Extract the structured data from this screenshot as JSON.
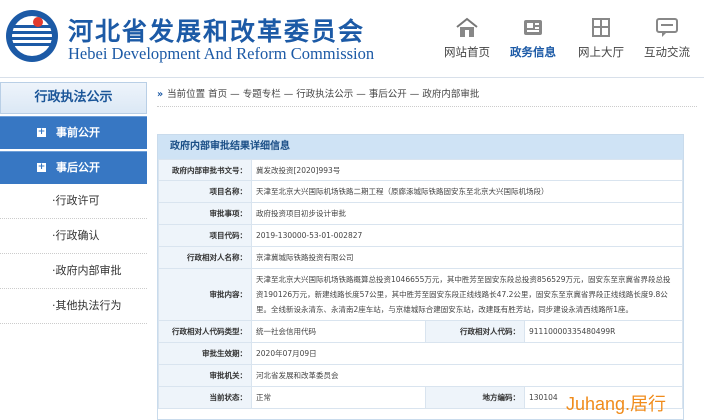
{
  "site": {
    "name_cn": "河北省发展和改革委员会",
    "name_en": "Hebei Development And Reform Commission",
    "brand_color": "#1c5aa6"
  },
  "nav": [
    {
      "label": "网站首页",
      "icon": "home-icon",
      "active": false
    },
    {
      "label": "政务信息",
      "icon": "news-icon",
      "active": true
    },
    {
      "label": "网上大厅",
      "icon": "hall-icon",
      "active": false
    },
    {
      "label": "互动交流",
      "icon": "chat-icon",
      "active": false
    }
  ],
  "sidebar": {
    "title": "行政执法公示",
    "cat1": "事前公开",
    "cat2": "事后公开",
    "items": [
      "·行政许可",
      "·行政确认",
      "·政府内部审批",
      "·其他执法行为"
    ]
  },
  "breadcrumb": "当前位置 首页 — 专题专栏 — 行政执法公示 — 事后公开 — 政府内部审批",
  "detail": {
    "title": "政府内部审批结果详细信息",
    "doc_no_label": "政府内部审批书文号：",
    "doc_no": "冀发改投资[2020]993号",
    "project_label": "项目名称：",
    "project": "天津至北京大兴国际机场铁路二期工程（原廊涿城际铁路固安东至北京大兴国际机场段）",
    "matter_label": "审批事项：",
    "matter": "政府投资项目初步设计审批",
    "code_label": "项目代码：",
    "code": "2019-130000-53-01-002827",
    "party_label": "行政相对人名称：",
    "party": "京津冀城际铁路投资有限公司",
    "content_label": "审批内容：",
    "content": "天津至北京大兴国际机场铁路概算总投资1046655万元，其中胜芳至固安东段总投资856529万元，固安东至京冀省界段总投资190126万元，新建线路长度57公里，其中胜芳至固安东段正线线路长47.2公里，固安东至京冀省界段正线线路长度9.8公里。全线新设永清东、永清南2座车站，与京雄城际合建固安东站，改建既有胜芳站，同步建设永清西线路所1座。",
    "cert_type_label": "行政相对人代码类型：",
    "cert_type": "统一社会信用代码",
    "party_code_label": "行政相对人代码：",
    "party_code": "91110000335480499R",
    "effective_label": "审批生效期：",
    "effective": "2020年07月09日",
    "authority_label": "审批机关：",
    "authority": "河北省发展和改革委员会",
    "status_label": "当前状态：",
    "status": "正常",
    "area_label": "地方编码：",
    "area": "130104"
  },
  "watermark": "Juhang.居行"
}
